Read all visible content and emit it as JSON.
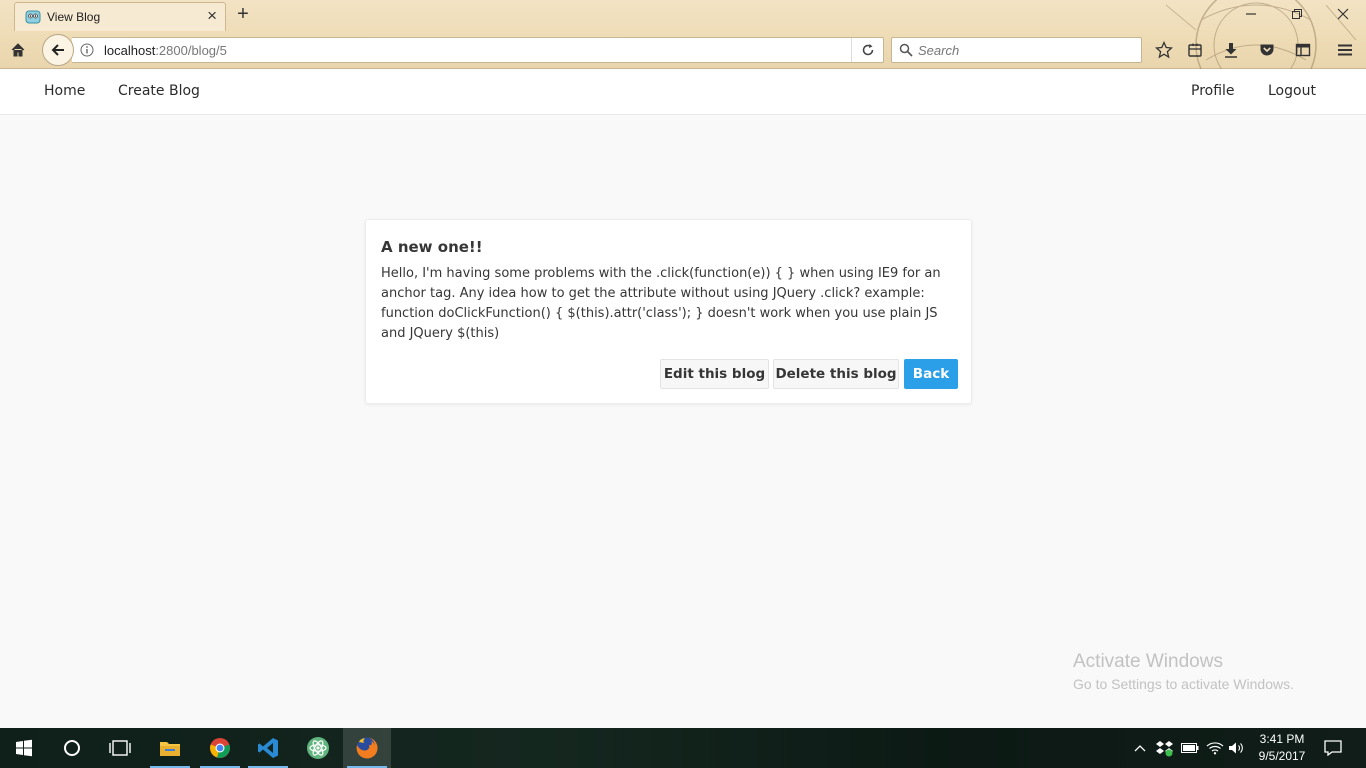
{
  "browser": {
    "tab_title": "View Blog",
    "url_host": "localhost",
    "url_rest": ":2800/blog/5",
    "search_placeholder": "Search"
  },
  "nav": {
    "home": "Home",
    "create_blog": "Create Blog",
    "profile": "Profile",
    "logout": "Logout"
  },
  "blog": {
    "title": "A new one!!",
    "body": "Hello, I'm having some problems with the .click(function(e)) { } when using IE9 for an anchor tag. Any idea how to get the attribute without using JQuery .click? example: function doClickFunction() { $(this).attr('class'); } doesn't work when you use plain JS and JQuery $(this)",
    "edit_label": "Edit this blog",
    "delete_label": "Delete this blog",
    "back_label": "Back"
  },
  "watermark": {
    "line1": "Activate Windows",
    "line2": "Go to Settings to activate Windows."
  },
  "taskbar": {
    "time": "3:41 PM",
    "date": "9/5/2017",
    "apps": [
      "start-icon",
      "cortana-icon",
      "task-view-icon",
      "file-explorer-icon",
      "chrome-icon",
      "vscode-icon",
      "atom-icon",
      "firefox-icon"
    ]
  },
  "colors": {
    "primary": "#2b9fe8",
    "chrome_bg": "#eedcb6",
    "page_bg": "#f9f9f9",
    "text": "#363636"
  }
}
